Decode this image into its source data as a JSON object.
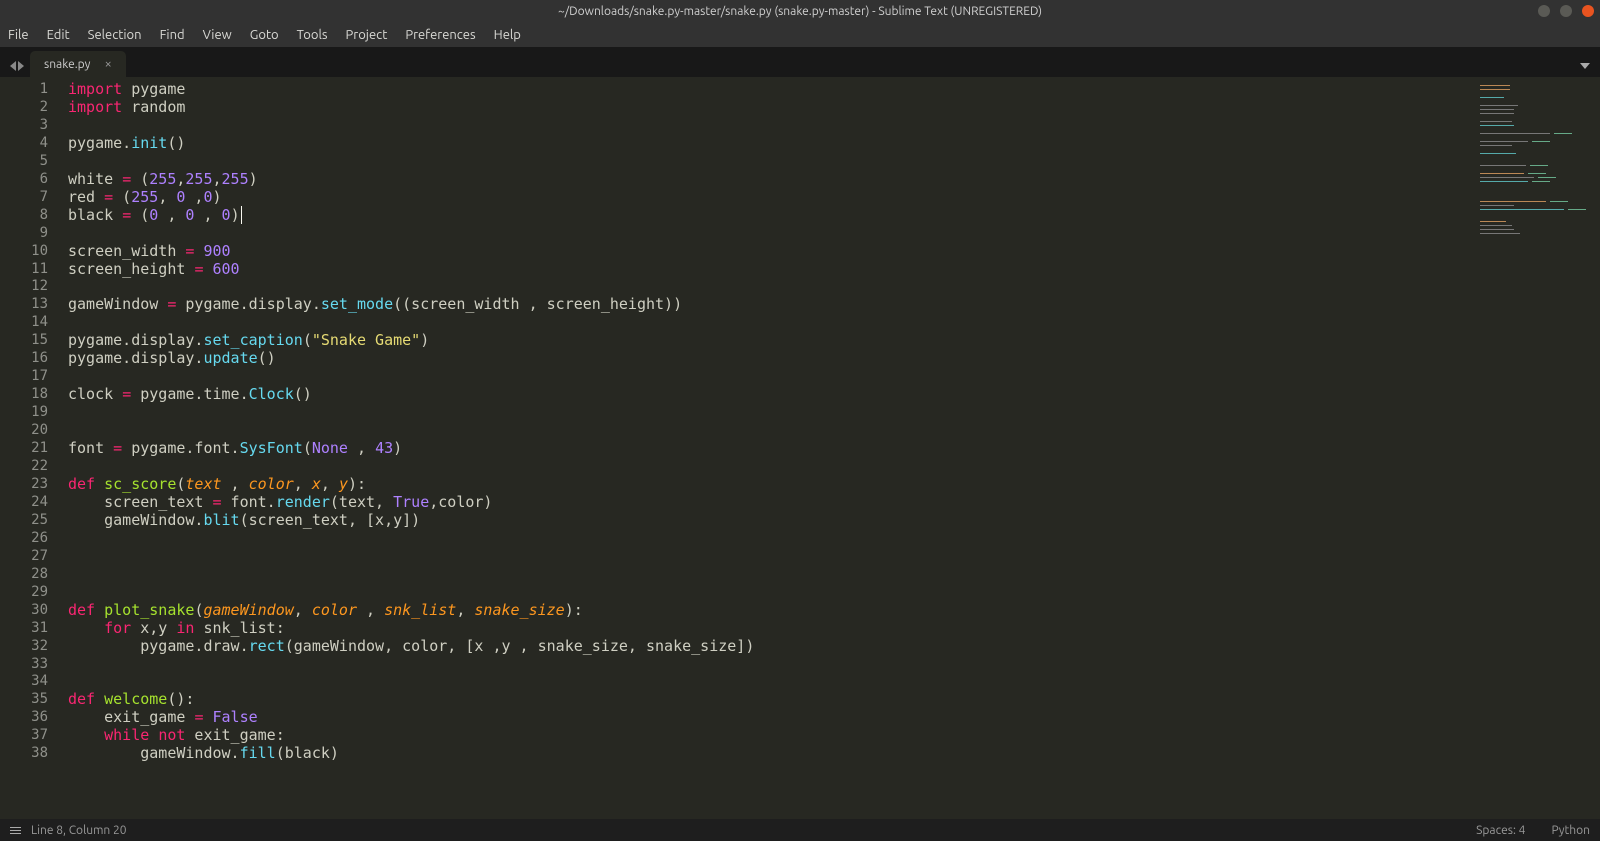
{
  "titlebar": {
    "title": "~/Downloads/snake.py-master/snake.py (snake.py-master) - Sublime Text (UNREGISTERED)"
  },
  "menubar": {
    "items": [
      "File",
      "Edit",
      "Selection",
      "Find",
      "View",
      "Goto",
      "Tools",
      "Project",
      "Preferences",
      "Help"
    ]
  },
  "tab": {
    "name": "snake.py"
  },
  "statusbar": {
    "position": "Line 8, Column 20",
    "spaces": "Spaces: 4",
    "syntax": "Python"
  },
  "code": {
    "lines": [
      {
        "n": 1,
        "tokens": [
          [
            "kw",
            "import"
          ],
          [
            "",
            " pygame"
          ]
        ]
      },
      {
        "n": 2,
        "tokens": [
          [
            "kw",
            "import"
          ],
          [
            "",
            " random"
          ]
        ]
      },
      {
        "n": 3,
        "tokens": [
          [
            "",
            ""
          ]
        ]
      },
      {
        "n": 4,
        "tokens": [
          [
            "",
            "pygame."
          ],
          [
            "fn",
            "init"
          ],
          [
            "",
            "()"
          ]
        ]
      },
      {
        "n": 5,
        "tokens": [
          [
            "",
            ""
          ]
        ]
      },
      {
        "n": 6,
        "tokens": [
          [
            "",
            "white "
          ],
          [
            "op",
            "="
          ],
          [
            "",
            " ("
          ],
          [
            "num",
            "255"
          ],
          [
            "",
            ","
          ],
          [
            "num",
            "255"
          ],
          [
            "",
            ","
          ],
          [
            "num",
            "255"
          ],
          [
            "",
            ")"
          ]
        ]
      },
      {
        "n": 7,
        "tokens": [
          [
            "",
            "red "
          ],
          [
            "op",
            "="
          ],
          [
            "",
            " ("
          ],
          [
            "num",
            "255"
          ],
          [
            "",
            ", "
          ],
          [
            "num",
            "0"
          ],
          [
            "",
            " ,"
          ],
          [
            "num",
            "0"
          ],
          [
            "",
            ")"
          ]
        ]
      },
      {
        "n": 8,
        "tokens": [
          [
            "",
            "black "
          ],
          [
            "op",
            "="
          ],
          [
            "",
            " ("
          ],
          [
            "num",
            "0"
          ],
          [
            "",
            " , "
          ],
          [
            "num",
            "0"
          ],
          [
            "",
            " , "
          ],
          [
            "num",
            "0"
          ],
          [
            "",
            ")"
          ]
        ],
        "cursor": true
      },
      {
        "n": 9,
        "tokens": [
          [
            "",
            ""
          ]
        ]
      },
      {
        "n": 10,
        "tokens": [
          [
            "",
            "screen_width "
          ],
          [
            "op",
            "="
          ],
          [
            "",
            " "
          ],
          [
            "num",
            "900"
          ]
        ]
      },
      {
        "n": 11,
        "tokens": [
          [
            "",
            "screen_height "
          ],
          [
            "op",
            "="
          ],
          [
            "",
            " "
          ],
          [
            "num",
            "600"
          ]
        ]
      },
      {
        "n": 12,
        "tokens": [
          [
            "",
            ""
          ]
        ]
      },
      {
        "n": 13,
        "tokens": [
          [
            "",
            "gameWindow "
          ],
          [
            "op",
            "="
          ],
          [
            "",
            " pygame.display."
          ],
          [
            "fn",
            "set_mode"
          ],
          [
            "",
            "((screen_width , screen_height))"
          ]
        ]
      },
      {
        "n": 14,
        "tokens": [
          [
            "",
            ""
          ]
        ]
      },
      {
        "n": 15,
        "tokens": [
          [
            "",
            "pygame.display."
          ],
          [
            "fn",
            "set_caption"
          ],
          [
            "",
            "("
          ],
          [
            "str",
            "\"Snake Game\""
          ],
          [
            "",
            ")"
          ]
        ]
      },
      {
        "n": 16,
        "tokens": [
          [
            "",
            "pygame.display."
          ],
          [
            "fn",
            "update"
          ],
          [
            "",
            "()"
          ]
        ]
      },
      {
        "n": 17,
        "tokens": [
          [
            "",
            ""
          ]
        ]
      },
      {
        "n": 18,
        "tokens": [
          [
            "",
            "clock "
          ],
          [
            "op",
            "="
          ],
          [
            "",
            " pygame.time."
          ],
          [
            "fn",
            "Clock"
          ],
          [
            "",
            "()"
          ]
        ]
      },
      {
        "n": 19,
        "tokens": [
          [
            "",
            ""
          ]
        ]
      },
      {
        "n": 20,
        "tokens": [
          [
            "",
            ""
          ]
        ]
      },
      {
        "n": 21,
        "tokens": [
          [
            "",
            "font "
          ],
          [
            "op",
            "="
          ],
          [
            "",
            " pygame.font."
          ],
          [
            "fn",
            "SysFont"
          ],
          [
            "",
            "("
          ],
          [
            "const",
            "None"
          ],
          [
            "",
            " , "
          ],
          [
            "num",
            "43"
          ],
          [
            "",
            ")"
          ]
        ]
      },
      {
        "n": 22,
        "tokens": [
          [
            "",
            ""
          ]
        ]
      },
      {
        "n": 23,
        "tokens": [
          [
            "kw",
            "def"
          ],
          [
            "",
            " "
          ],
          [
            "def",
            "sc_score"
          ],
          [
            "",
            "("
          ],
          [
            "par",
            "text"
          ],
          [
            "",
            " , "
          ],
          [
            "par",
            "color"
          ],
          [
            "",
            ", "
          ],
          [
            "par",
            "x"
          ],
          [
            "",
            ", "
          ],
          [
            "par",
            "y"
          ],
          [
            "",
            "):"
          ]
        ]
      },
      {
        "n": 24,
        "tokens": [
          [
            "",
            "    screen_text "
          ],
          [
            "op",
            "="
          ],
          [
            "",
            " font."
          ],
          [
            "fn",
            "render"
          ],
          [
            "",
            "(text, "
          ],
          [
            "const",
            "True"
          ],
          [
            "",
            ",color)"
          ]
        ]
      },
      {
        "n": 25,
        "tokens": [
          [
            "",
            "    gameWindow."
          ],
          [
            "fn",
            "blit"
          ],
          [
            "",
            "(screen_text, [x,y])"
          ]
        ]
      },
      {
        "n": 26,
        "tokens": [
          [
            "",
            ""
          ]
        ]
      },
      {
        "n": 27,
        "tokens": [
          [
            "",
            ""
          ]
        ]
      },
      {
        "n": 28,
        "tokens": [
          [
            "",
            ""
          ]
        ]
      },
      {
        "n": 29,
        "tokens": [
          [
            "",
            ""
          ]
        ]
      },
      {
        "n": 30,
        "tokens": [
          [
            "kw",
            "def"
          ],
          [
            "",
            " "
          ],
          [
            "def",
            "plot_snake"
          ],
          [
            "",
            "("
          ],
          [
            "par",
            "gameWindow"
          ],
          [
            "",
            ", "
          ],
          [
            "par",
            "color"
          ],
          [
            "",
            " , "
          ],
          [
            "par",
            "snk_list"
          ],
          [
            "",
            ", "
          ],
          [
            "par",
            "snake_size"
          ],
          [
            "",
            "):"
          ]
        ]
      },
      {
        "n": 31,
        "tokens": [
          [
            "",
            "    "
          ],
          [
            "kw",
            "for"
          ],
          [
            "",
            " x,y "
          ],
          [
            "kw",
            "in"
          ],
          [
            "",
            " snk_list:"
          ]
        ]
      },
      {
        "n": 32,
        "tokens": [
          [
            "",
            "        pygame.draw."
          ],
          [
            "fn",
            "rect"
          ],
          [
            "",
            "(gameWindow, color, [x ,y , snake_size, snake_size])"
          ]
        ]
      },
      {
        "n": 33,
        "tokens": [
          [
            "",
            ""
          ]
        ]
      },
      {
        "n": 34,
        "tokens": [
          [
            "",
            ""
          ]
        ]
      },
      {
        "n": 35,
        "tokens": [
          [
            "kw",
            "def"
          ],
          [
            "",
            " "
          ],
          [
            "def",
            "welcome"
          ],
          [
            "",
            "():"
          ]
        ]
      },
      {
        "n": 36,
        "tokens": [
          [
            "",
            "    exit_game "
          ],
          [
            "op",
            "="
          ],
          [
            "",
            " "
          ],
          [
            "const",
            "False"
          ]
        ]
      },
      {
        "n": 37,
        "tokens": [
          [
            "",
            "    "
          ],
          [
            "kw",
            "while"
          ],
          [
            "",
            " "
          ],
          [
            "kw",
            "not"
          ],
          [
            "",
            " exit_game:"
          ]
        ]
      },
      {
        "n": 38,
        "tokens": [
          [
            "",
            "        gameWindow."
          ],
          [
            "fn",
            "fill"
          ],
          [
            "",
            "(black)"
          ]
        ]
      }
    ]
  }
}
